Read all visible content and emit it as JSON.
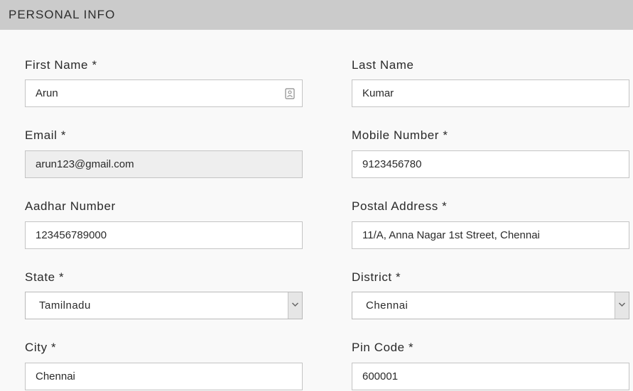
{
  "header": {
    "title": "PERSONAL INFO"
  },
  "fields": {
    "first_name": {
      "label": "First Name *",
      "value": "Arun"
    },
    "last_name": {
      "label": "Last Name",
      "value": "Kumar"
    },
    "email": {
      "label": "Email *",
      "value": "arun123@gmail.com"
    },
    "mobile": {
      "label": "Mobile Number *",
      "value": "9123456780"
    },
    "aadhar": {
      "label": "Aadhar Number",
      "value": "123456789000"
    },
    "postal_address": {
      "label": "Postal Address *",
      "value": "11/A, Anna Nagar 1st Street, Chennai"
    },
    "state": {
      "label": "State *",
      "value": "Tamilnadu"
    },
    "district": {
      "label": "District *",
      "value": "Chennai"
    },
    "city": {
      "label": "City *",
      "value": "Chennai"
    },
    "pin_code": {
      "label": "Pin Code *",
      "value": "600001"
    }
  },
  "icons": {
    "contact": "contact-card-icon",
    "dropdown": "chevron-down-icon"
  },
  "colors": {
    "header_bg": "#cbcbcb",
    "page_bg": "#f9f9f9",
    "disabled_field_bg": "#eeeeee",
    "border": "#c4c4c4"
  }
}
